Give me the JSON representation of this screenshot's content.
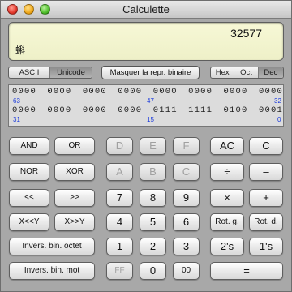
{
  "window": {
    "title": "Calculette"
  },
  "display": {
    "value": "32577",
    "char": "蝌"
  },
  "charset": {
    "options": [
      "ASCII",
      "Unicode"
    ],
    "selected": "Unicode"
  },
  "hide_binary_label": "Masquer la repr. binaire",
  "base": {
    "options": [
      "Hex",
      "Oct",
      "Dec"
    ],
    "selected": "Dec"
  },
  "binary": {
    "row1": [
      "0000",
      "0000",
      "0000",
      "0000",
      "0000",
      "0000",
      "0000",
      "0000"
    ],
    "row1_labels": [
      "63",
      "47",
      "32"
    ],
    "row2": [
      "0000",
      "0000",
      "0000",
      "0000",
      "0111",
      "1111",
      "0100",
      "0001"
    ],
    "row2_labels": [
      "31",
      "15",
      "0"
    ]
  },
  "keys": {
    "and": "AND",
    "or": "OR",
    "nor": "NOR",
    "xor": "XOR",
    "shl": "<<",
    "shr": ">>",
    "rotl_y": "X<<Y",
    "rotr_y": "X>>Y",
    "inv_byte": "Invers. bin. octet",
    "inv_word": "Invers. bin. mot",
    "d": "D",
    "e": "E",
    "f": "F",
    "a": "A",
    "b": "B",
    "c_hex": "C",
    "n7": "7",
    "n8": "8",
    "n9": "9",
    "n4": "4",
    "n5": "5",
    "n6": "6",
    "n1": "1",
    "n2": "2",
    "n3": "3",
    "ff": "FF",
    "n0": "0",
    "n00": "00",
    "ac": "AC",
    "c": "C",
    "div": "÷",
    "minus": "–",
    "mul": "×",
    "plus": "+",
    "rot_left": "Rot. g.",
    "rot_right": "Rot. d.",
    "twos": "2's",
    "ones": "1's",
    "equals": "="
  }
}
